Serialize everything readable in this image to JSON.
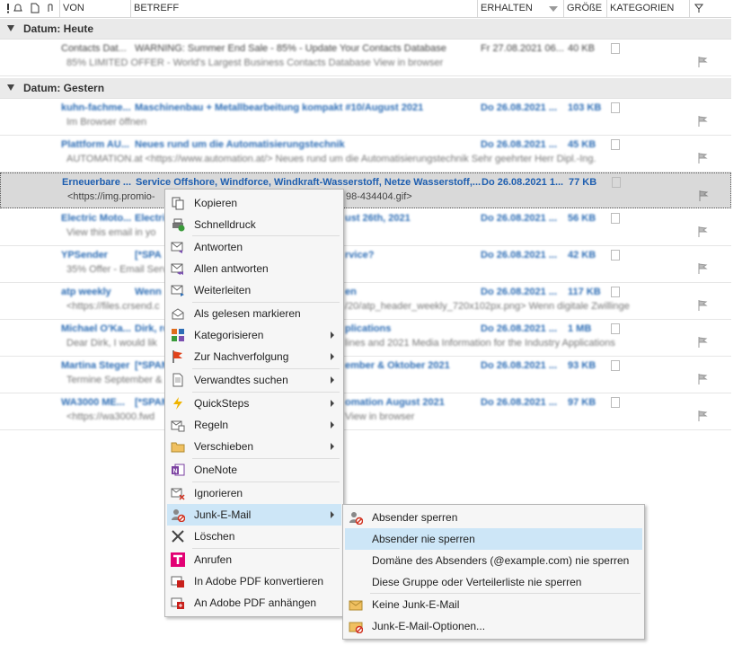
{
  "header": {
    "from": "VON",
    "subject": "BETREFF",
    "received": "ERHALTEN",
    "size": "GRÖßE",
    "categories": "KATEGORIEN"
  },
  "groups": [
    {
      "label": "Datum: Heute"
    },
    {
      "label": "Datum: Gestern"
    }
  ],
  "messages": [
    {
      "from": "Contacts Dat...",
      "subject": "WARNING: Summer End Sale - 85% - Update Your Contacts Database",
      "preview": "85% LIMITED OFFER - World's Largest Business Contacts Database                                   View in browser",
      "date": "Fr 27.08.2021 06...",
      "size": "40 KB"
    },
    {
      "from": "kuhn-fachme...",
      "subject": "Maschinenbau + Metallbearbeitung kompakt #10/August 2021",
      "preview": "Im Browser öffnen",
      "date": "Do 26.08.2021 ...",
      "size": "103 KB"
    },
    {
      "from": "Plattform AU...",
      "subject": "Neues rund um die Automatisierungstechnik",
      "preview": "AUTOMATION.at <https://www.automation.at/>    Neues rund um die Automatisierungstechnik  Sehr geehrter Herr Dipl.-Ing.",
      "date": "Do 26.08.2021 ...",
      "size": "45 KB"
    },
    {
      "from": "Erneuerbare ...",
      "subject": "Service Offshore, Windforce, Windkraft-Wasserstoff, Netze Wasserstoff,...",
      "preview": "<https://img.promio-",
      "preview2": "98-434404.gif>",
      "date": "Do 26.08.2021 1...",
      "size": "77 KB"
    },
    {
      "from": "Electric Moto...",
      "subject": "Electri",
      "subject2": "ust 26th, 2021",
      "preview": "View this email in yo",
      "date": "Do 26.08.2021 ...",
      "size": "56 KB"
    },
    {
      "from": "YPSender",
      "subject": "[*SPA",
      "subject2": "rvice?",
      "preview": "35% Offer - Email Servi",
      "date": "Do 26.08.2021 ...",
      "size": "42 KB"
    },
    {
      "from": "atp weekly",
      "subject": "Wenn",
      "subject2": "en",
      "preview": "<https://files.crsend.c",
      "preview2": "/20/atp_header_weekly_720x102px.png>  Wenn digitale Zwillinge",
      "date": "Do 26.08.2021 ...",
      "size": "117 KB"
    },
    {
      "from": "Michael O'Ka...",
      "subject": "Dirk, ro",
      "subject2": "plications",
      "preview": "Dear Dirk, I would lik",
      "preview2": "lines and 2021 Media Information for the Industry Applications",
      "date": "Do 26.08.2021 ...",
      "size": "1 MB"
    },
    {
      "from": "Martina Steger",
      "subject": "[*SPAM",
      "subject2": "ember & Oktober 2021",
      "preview": "Termine September &",
      "date": "Do 26.08.2021 ...",
      "size": "93 KB"
    },
    {
      "from": "WA3000 ME...",
      "subject": "[*SPAM",
      "subject2": "omation August 2021",
      "preview": "<https://wa3000.fwd",
      "preview2": "  View in browser",
      "date": "Do 26.08.2021 ...",
      "size": "97 KB"
    }
  ],
  "context_menu": [
    {
      "label": "Kopieren",
      "icon": "copy-icon"
    },
    {
      "label": "Schnelldruck",
      "icon": "quick-print-icon"
    },
    {
      "label": "Antworten",
      "icon": "reply-icon"
    },
    {
      "label": "Allen antworten",
      "icon": "reply-all-icon"
    },
    {
      "label": "Weiterleiten",
      "icon": "forward-icon"
    },
    {
      "label": "Als gelesen markieren",
      "icon": "mark-read-icon"
    },
    {
      "label": "Kategorisieren",
      "icon": "categorize-icon"
    },
    {
      "label": "Zur Nachverfolgung",
      "icon": "flag-icon"
    },
    {
      "label": "Verwandtes suchen",
      "icon": "find-related-icon"
    },
    {
      "label": "QuickSteps",
      "icon": "lightning-icon"
    },
    {
      "label": "Regeln",
      "icon": "rules-icon"
    },
    {
      "label": "Verschieben",
      "icon": "folder-move-icon"
    },
    {
      "label": "OneNote",
      "icon": "onenote-icon"
    },
    {
      "label": "Ignorieren",
      "icon": "ignore-icon"
    },
    {
      "label": "Junk-E-Mail",
      "icon": "junk-icon"
    },
    {
      "label": "Löschen",
      "icon": "delete-icon"
    },
    {
      "label": "Anrufen",
      "icon": "telekom-icon"
    },
    {
      "label": "In Adobe PDF konvertieren",
      "icon": "pdf-convert-icon"
    },
    {
      "label": "An Adobe PDF anhängen",
      "icon": "pdf-append-icon"
    }
  ],
  "submenu": [
    {
      "label": "Absender sperren",
      "icon": "block-sender-icon"
    },
    {
      "label": "Absender nie sperren"
    },
    {
      "label": "Domäne des Absenders (@example.com) nie sperren"
    },
    {
      "label": "Diese Gruppe oder Verteilerliste nie sperren"
    },
    {
      "label": "Keine Junk-E-Mail",
      "icon": "not-junk-icon"
    },
    {
      "label": "Junk-E-Mail-Optionen...",
      "icon": "junk-options-icon"
    }
  ],
  "colors": {
    "accent": "#2d6db5",
    "highlight": "#cde6f7",
    "group_bg": "#eaeaea"
  }
}
